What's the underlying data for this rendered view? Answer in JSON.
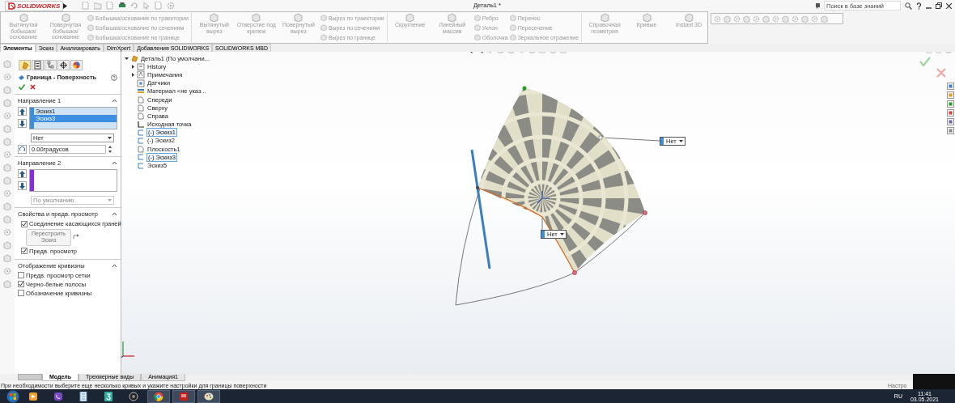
{
  "title_bar": {
    "app_name": "SOLIDWORKS",
    "document_title": "Деталь1 *",
    "search": {
      "placeholder": "Поиск в базе знаний"
    }
  },
  "ribbon": {
    "groups": [
      {
        "commands": [
          {
            "kind": "large",
            "disabled": true,
            "label": "Вытянутая бобышка/основание"
          },
          {
            "kind": "large",
            "disabled": true,
            "label": "Повернутая бобышка/основание"
          },
          {
            "kind": "stack",
            "disabled": true,
            "items": [
              "Бобышка/основание по траектории",
              "Бобышка/основание по сечениям",
              "Бобышка/основание на границе"
            ]
          }
        ]
      },
      {
        "commands": [
          {
            "kind": "large",
            "disabled": true,
            "label": "Вытянутый вырез"
          },
          {
            "kind": "large",
            "disabled": true,
            "label": "Отверстие под крепеж"
          },
          {
            "kind": "large",
            "disabled": true,
            "label": "Повернутый вырез"
          },
          {
            "kind": "stack",
            "disabled": true,
            "items": [
              "Вырез по траектории",
              "Вырез по сечениям",
              "Вырез по границе"
            ]
          }
        ]
      },
      {
        "commands": [
          {
            "kind": "large",
            "disabled": true,
            "label": "Скругление"
          },
          {
            "kind": "large",
            "disabled": true,
            "label": "Линейный массив"
          },
          {
            "kind": "stack",
            "disabled": true,
            "items": [
              "Ребро",
              "Уклон",
              "Оболочка"
            ]
          },
          {
            "kind": "stack",
            "disabled": true,
            "items": [
              "Перенос",
              "Пересечение",
              "Зеркальное отражение"
            ]
          }
        ]
      },
      {
        "commands": [
          {
            "kind": "large",
            "disabled": true,
            "label": "Справочная геометрия"
          },
          {
            "kind": "large",
            "disabled": true,
            "label": "Кривые"
          },
          {
            "kind": "large",
            "disabled": true,
            "label": "Instant 3D"
          }
        ]
      }
    ]
  },
  "command_tabs": [
    {
      "label": "Элементы",
      "selected": true
    },
    {
      "label": "Эскиз",
      "selected": false
    },
    {
      "label": "Анализировать",
      "selected": false
    },
    {
      "label": "DimXpert",
      "selected": false
    },
    {
      "label": "Добавления SOLIDWORKS",
      "selected": false
    },
    {
      "label": "SOLIDWORKS MBD",
      "selected": false
    }
  ],
  "property_manager": {
    "panel_tabs": [
      {
        "kind": "features",
        "selected": true
      },
      {
        "kind": "properties",
        "selected": false
      },
      {
        "kind": "configurations",
        "selected": false
      },
      {
        "kind": "dimxpert",
        "selected": false
      },
      {
        "kind": "appearance",
        "selected": false
      }
    ],
    "title": "Граница - Поверхность",
    "sections": [
      {
        "kind": "direction",
        "title": "Направление 1",
        "color": "#3a8fd8",
        "items": [
          {
            "label": "Эскиз1",
            "selected": false
          },
          {
            "label": "Эскиз3",
            "selected": true
          }
        ],
        "dropdown": {
          "value": "Нет",
          "disabled": false
        },
        "angle": "0.00градусов"
      },
      {
        "kind": "direction",
        "title": "Направление 2",
        "color": "#8a2be2",
        "dropdown": {
          "value": "По умолчанию",
          "disabled": true
        }
      },
      {
        "kind": "options",
        "title": "Свойства и предв. просмотр",
        "rows": [
          {
            "kind": "checkbox",
            "label": "Соединение касающихся граней",
            "checked": true
          },
          {
            "kind": "button",
            "label": "Перестроить Эскиз",
            "disabled": true
          },
          {
            "kind": "checkbox",
            "label": "Предв. просмотр",
            "checked": true
          }
        ]
      },
      {
        "kind": "options",
        "title": "Отображение кривизны",
        "rows": [
          {
            "kind": "checkbox",
            "label": "Предв. просмотр сетки",
            "checked": false
          },
          {
            "kind": "checkbox",
            "label": "Черно-белые полосы",
            "checked": true
          },
          {
            "kind": "checkbox",
            "label": "Обозначение кривизны",
            "checked": false
          }
        ]
      }
    ]
  },
  "feature_tree": {
    "label": "Деталь1  (По умолчани...",
    "kind": "part",
    "expanded": true,
    "children": [
      {
        "label": "History",
        "kind": "folder",
        "expanded": false,
        "selected": false
      },
      {
        "label": "Примечания",
        "kind": "annotation",
        "expanded": false,
        "selected": false
      },
      {
        "label": "Датчики",
        "kind": "sensor",
        "selected": false
      },
      {
        "label": "Материал <не указ...",
        "kind": "material",
        "selected": false
      },
      {
        "label": "Спереди",
        "kind": "plane",
        "selected": false
      },
      {
        "label": "Сверху",
        "kind": "plane",
        "selected": false
      },
      {
        "label": "Справа",
        "kind": "plane",
        "selected": false
      },
      {
        "label": "Исходная точка",
        "kind": "origin",
        "selected": false
      },
      {
        "label": "(-) Эскиз1",
        "kind": "sketch",
        "selected": true
      },
      {
        "label": "(-) Эскиз2",
        "kind": "sketch",
        "selected": false
      },
      {
        "label": "Плоскость1",
        "kind": "plane",
        "selected": false
      },
      {
        "label": "(-) Эскиз3",
        "kind": "sketch",
        "selected": true
      },
      {
        "label": "Эскиз5",
        "kind": "sketch",
        "selected": false
      }
    ]
  },
  "viewport": {
    "callouts": [
      {
        "label": "Нет"
      },
      {
        "label": "Нет"
      }
    ]
  },
  "bottom_tabs": [
    {
      "label": "Модель",
      "selected": true
    },
    {
      "label": "Трехмерные виды",
      "selected": false
    },
    {
      "label": "Анимация1",
      "selected": false
    }
  ],
  "status_bar": {
    "message": "При необходимости выберите еще несколько кривых и укажите настройки для границы поверхности",
    "right_text": "Настро"
  },
  "taskbar": {
    "apps": [
      {
        "kind": "media",
        "running": false
      },
      {
        "kind": "chat",
        "running": false
      },
      {
        "kind": "document",
        "running": false
      },
      {
        "kind": "three",
        "running": false
      },
      {
        "kind": "camera",
        "running": false
      },
      {
        "kind": "browser",
        "running": true
      },
      {
        "kind": "solidworks",
        "running": true
      },
      {
        "kind": "paint",
        "running": true
      }
    ],
    "language": "RU",
    "time": "11:41",
    "date": "03.05.2021"
  }
}
